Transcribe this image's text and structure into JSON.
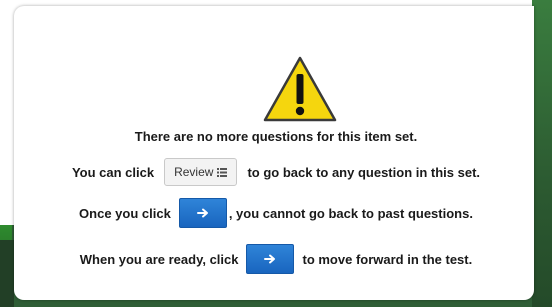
{
  "dialog": {
    "icon": "warning-icon",
    "title": "There are no more questions for this item set.",
    "line_review_pre": "You can click",
    "review_button_label": "Review",
    "review_button_icon": "list-icon",
    "line_review_post": "to go back to any question in this set.",
    "line_once_pre": "Once you click",
    "line_once_post": ", you cannot go back to past questions.",
    "line_ready_pre": "When you are ready, click",
    "line_ready_post": "to move forward in the test.",
    "next_button_icon": "arrow-right-icon"
  },
  "colors": {
    "accent_blue": "#1f6fc9",
    "warning_yellow": "#f5d60e",
    "background_green": "#2f5e36"
  }
}
